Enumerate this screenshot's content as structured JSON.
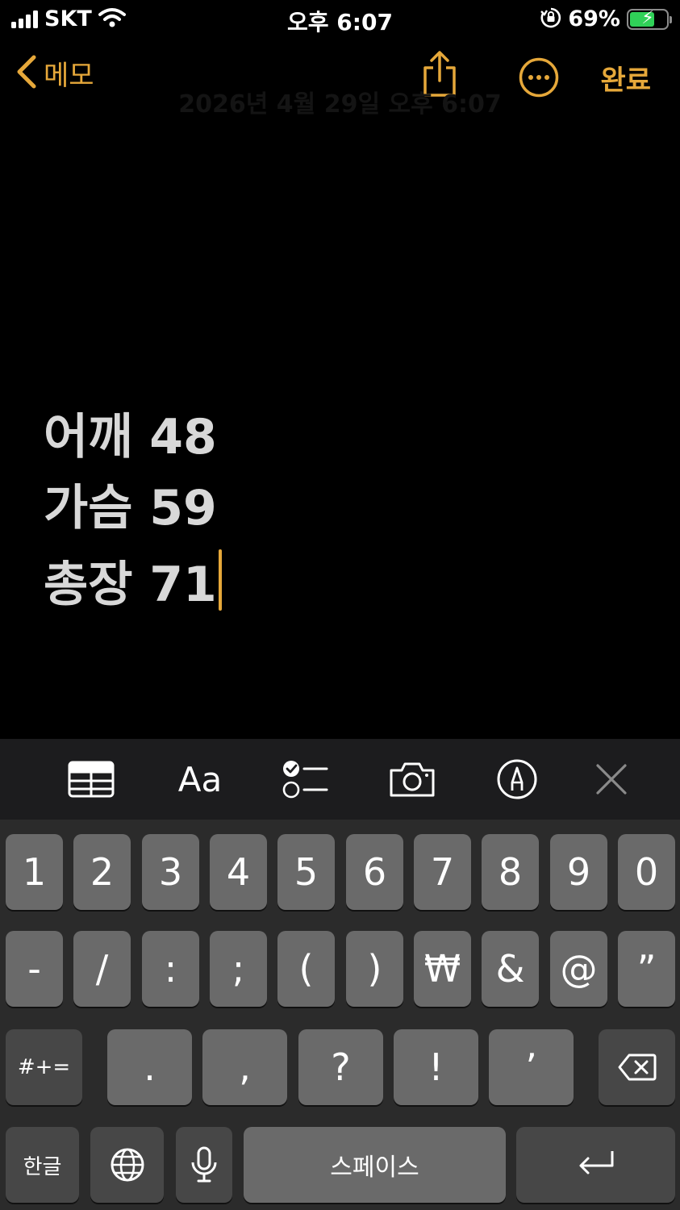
{
  "status_bar": {
    "carrier": "SKT",
    "time": "오후 6:07",
    "battery_percent": "69%",
    "battery_level": 0.69,
    "icons": [
      "signal-icon",
      "wifi-icon",
      "orientation-lock-icon",
      "battery-charging-icon"
    ]
  },
  "nav": {
    "back_label": "메모",
    "done_label": "완료",
    "date_header": "2026년 4월 29일 오후 6:07"
  },
  "note": {
    "lines": [
      "어깨 48",
      "가슴 59",
      "총장 71"
    ]
  },
  "toolbar": {
    "format_label": "Aa",
    "icons": [
      "table-icon",
      "format-icon",
      "checklist-icon",
      "camera-icon",
      "markup-icon",
      "close-icon"
    ]
  },
  "keyboard": {
    "row1": [
      "1",
      "2",
      "3",
      "4",
      "5",
      "6",
      "7",
      "8",
      "9",
      "0"
    ],
    "row2": [
      "-",
      "/",
      ":",
      ";",
      "(",
      ")",
      "₩",
      "&",
      "@",
      "”"
    ],
    "symbols_label": "#+=",
    "row3": [
      ".",
      ",",
      "?",
      "!",
      "’"
    ],
    "hangul_label": "한글",
    "space_label": "스페이스"
  },
  "colors": {
    "accent": "#e6a83a",
    "key": "#6a6a6a",
    "key_dark": "#474747",
    "toolbar_bg": "#1c1c1e",
    "battery_fill": "#30d158"
  }
}
